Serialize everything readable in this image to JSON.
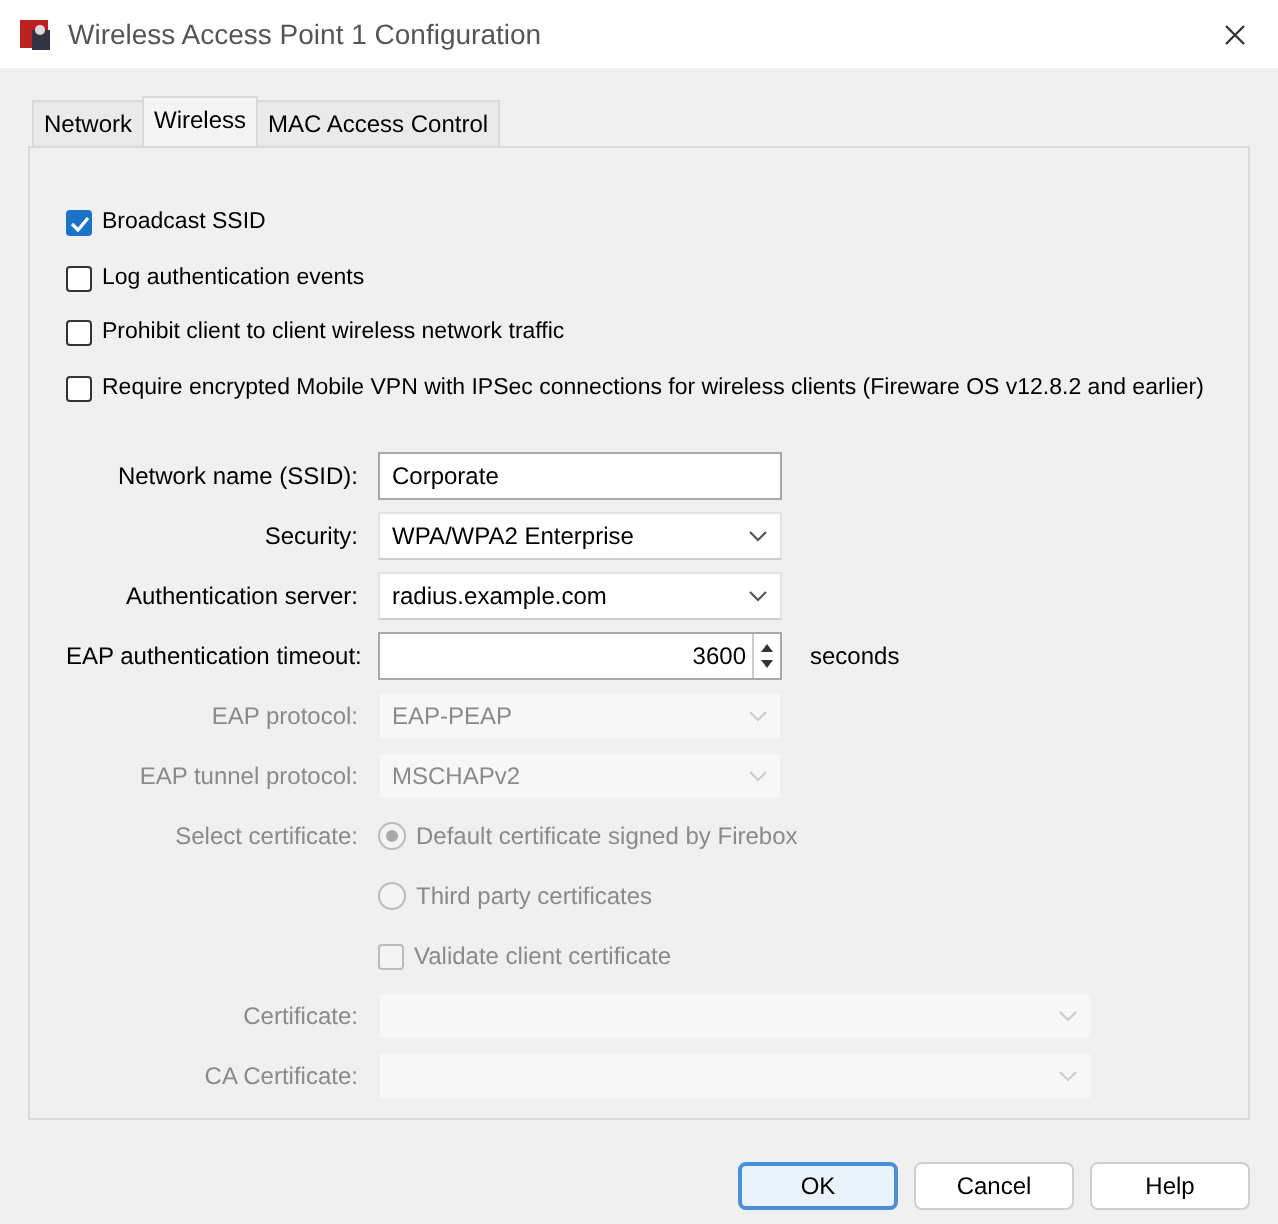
{
  "window": {
    "title": "Wireless Access Point 1 Configuration"
  },
  "tabs": [
    {
      "label": "Network",
      "selected": false
    },
    {
      "label": "Wireless",
      "selected": true
    },
    {
      "label": "MAC Access Control",
      "selected": false
    }
  ],
  "options": [
    {
      "label": "Broadcast SSID",
      "checked": true
    },
    {
      "label": "Log authentication events",
      "checked": false
    },
    {
      "label": "Prohibit client to client wireless network traffic",
      "checked": false
    },
    {
      "label": "Require encrypted Mobile VPN with IPSec connections for wireless clients (Fireware OS v12.8.2 and earlier)",
      "checked": false
    }
  ],
  "form": [
    {
      "kind": "text",
      "label": "Network name (SSID):",
      "value": "Corporate",
      "disabled": false
    },
    {
      "kind": "select",
      "label": "Security:",
      "value": "WPA/WPA2 Enterprise",
      "disabled": false
    },
    {
      "kind": "select",
      "label": "Authentication server:",
      "value": "radius.example.com",
      "disabled": false
    },
    {
      "kind": "spinner",
      "label": "EAP authentication timeout:",
      "value": "3600",
      "unit": "seconds",
      "disabled": false
    },
    {
      "kind": "select",
      "label": "EAP protocol:",
      "value": "EAP-PEAP",
      "disabled": true
    },
    {
      "kind": "select",
      "label": "EAP tunnel protocol:",
      "value": "MSCHAPv2",
      "disabled": true
    },
    {
      "kind": "radio",
      "label": "Select certificate:",
      "option": "Default certificate signed by Firebox",
      "selected": true,
      "disabled": true
    },
    {
      "kind": "radio",
      "option": "Third party certificates",
      "selected": false,
      "disabled": true
    },
    {
      "kind": "checkbox",
      "option": "Validate client certificate",
      "checked": false,
      "disabled": true
    },
    {
      "kind": "long-select",
      "label": "Certificate:",
      "disabled": true
    },
    {
      "kind": "long-select",
      "label": "CA Certificate:",
      "disabled": true
    }
  ],
  "buttons": [
    {
      "label": "OK",
      "default": true
    },
    {
      "label": "Cancel",
      "default": false
    },
    {
      "label": "Help",
      "default": false
    }
  ]
}
